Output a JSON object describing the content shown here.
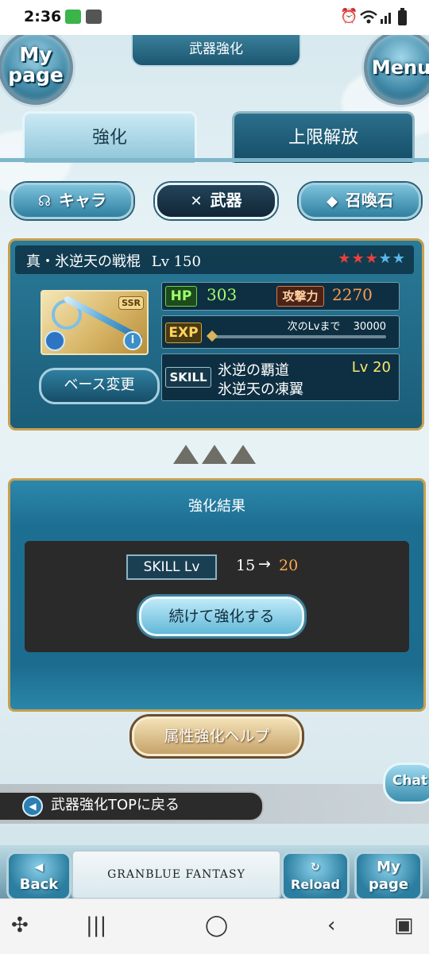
{
  "status_bar": {
    "time": "2:36"
  },
  "header": {
    "title": "武器強化",
    "mypage_line1": "My",
    "mypage_line2": "page",
    "menu_label": "Menu"
  },
  "tabs": [
    {
      "label": "強化",
      "active": true
    },
    {
      "label": "上限解放",
      "active": false
    }
  ],
  "categories": [
    {
      "label": "キャラ",
      "icon": "character-icon"
    },
    {
      "label": "武器",
      "icon": "crossed-swords-icon",
      "active": true
    },
    {
      "label": "召喚石",
      "icon": "crystal-icon"
    }
  ],
  "weapon": {
    "name": "真・氷逆天の戦棍",
    "level_text": "Lv 150",
    "rarity_badge": "SSR",
    "stars_filled": 3,
    "stars_total": 5,
    "base_change_label": "ベース変更",
    "hp_label": "HP",
    "hp": "303",
    "atk_label": "攻撃力",
    "atk": "2270",
    "exp_label": "EXP",
    "next_lv_text": "次のLvまで",
    "next_lv_value": "30000",
    "skill_label": "SKILL",
    "skills": [
      "氷逆の覇道",
      "氷逆天の凍翼"
    ],
    "skill_level": "Lv 20"
  },
  "result": {
    "title": "強化結果",
    "skill_lv_label": "SKILL Lv",
    "before": "15",
    "arrow": "→",
    "after": "20",
    "continue_label": "続けて強化する"
  },
  "help_label": "属性強化ヘルプ",
  "chat_label": "Chat",
  "back_top_label": "武器強化TOPに戻る",
  "footer": {
    "back_label": "Back",
    "logo_text": "GRANBLUE FANTASY",
    "reload_label": "Reload",
    "mypage_line1": "My",
    "mypage_line2": "page"
  },
  "colors": {
    "accent_blue": "#2a7a98",
    "gold_frame": "#c8a04e",
    "result_orange": "#ffa94a"
  }
}
